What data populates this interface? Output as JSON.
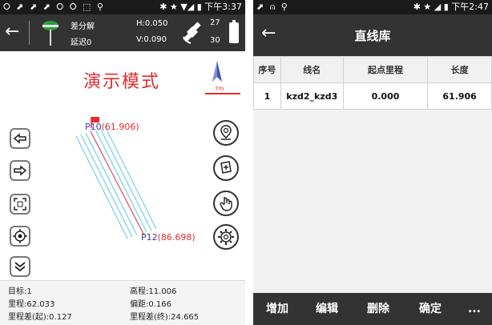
{
  "left": {
    "status": {
      "left_icons": "⭘ ⬈ ⬈ ⬈ ⭘ ⭘ ⬚ ⚲",
      "right": "✱ ★ ▼◢ ▮ 下午3:37"
    },
    "header": {
      "back": "←",
      "fix": "差分解",
      "delay": "延迟0",
      "h": "H:0.050",
      "v": "V:0.090",
      "sat_used": "27",
      "sat_total": "30"
    },
    "map": {
      "mode_title": "演示模式",
      "north_label": "N",
      "scale": "7m",
      "start_point": {
        "name": "P10",
        "value": "(61.906)"
      },
      "end_point": {
        "name": "P12",
        "value": "(86.698)"
      }
    },
    "info": {
      "target": "目标:1",
      "elevation": "高程:11.006",
      "mileage": "里程:62.033",
      "offset": "偏距:0.166",
      "diff_start": "里程差(起):0.127",
      "diff_end": "里程差(终):24.665"
    }
  },
  "right": {
    "status": {
      "left_icons": "⬈ ⍝ ⚲",
      "right": "✱ ★ ◢ ▮ 下午2:47"
    },
    "header": {
      "back": "←",
      "title": "直线库"
    },
    "table": {
      "headers": [
        "序号",
        "线名",
        "起点里程",
        "长度"
      ],
      "rows": [
        [
          "1",
          "kzd2_kzd3",
          "0.000",
          "61.906"
        ]
      ]
    },
    "buttons": {
      "add": "增加",
      "edit": "编辑",
      "delete": "删除",
      "confirm": "确定",
      "more": "..."
    }
  }
}
